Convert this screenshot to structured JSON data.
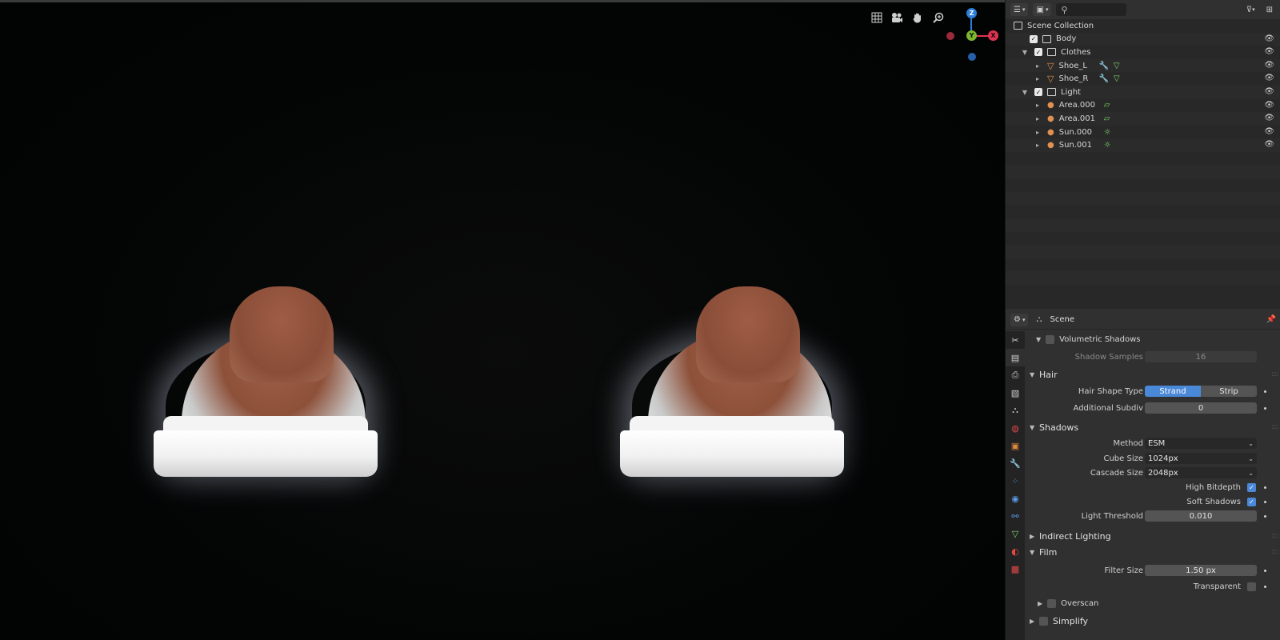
{
  "outliner": {
    "search_placeholder": "",
    "scene_collection": "Scene Collection",
    "items": [
      {
        "label": "Body"
      },
      {
        "label": "Clothes"
      },
      {
        "label": "Shoe_L"
      },
      {
        "label": "Shoe_R"
      },
      {
        "label": "Light"
      },
      {
        "label": "Area.000"
      },
      {
        "label": "Area.001"
      },
      {
        "label": "Sun.000"
      },
      {
        "label": "Sun.001"
      }
    ]
  },
  "gizmo": {
    "z": "Z",
    "y": "Y",
    "x": "X"
  },
  "properties": {
    "context": "Scene",
    "volumetric_shadows": "Volumetric Shadows",
    "shadow_samples_label": "Shadow Samples",
    "shadow_samples_value": "16",
    "hair_title": "Hair",
    "hair_shape_type_label": "Hair Shape Type",
    "hair_shape_options": [
      "Strand",
      "Strip"
    ],
    "additional_subdiv_label": "Additional Subdiv",
    "additional_subdiv_value": "0",
    "shadows_title": "Shadows",
    "method_label": "Method",
    "method_value": "ESM",
    "cube_size_label": "Cube Size",
    "cube_size_value": "1024px",
    "cascade_size_label": "Cascade Size",
    "cascade_size_value": "2048px",
    "high_bitdepth_label": "High Bitdepth",
    "soft_shadows_label": "Soft Shadows",
    "light_threshold_label": "Light Threshold",
    "light_threshold_value": "0.010",
    "indirect_lighting_title": "Indirect Lighting",
    "film_title": "Film",
    "filter_size_label": "Filter Size",
    "filter_size_value": "1.50 px",
    "transparent_label": "Transparent",
    "overscan_label": "Overscan",
    "simplify_title": "Simplify"
  },
  "colors": {
    "accent": "#4a88d8",
    "x_axis": "#e0334f",
    "y_axis": "#7ab82f",
    "z_axis": "#2d7fd9"
  }
}
